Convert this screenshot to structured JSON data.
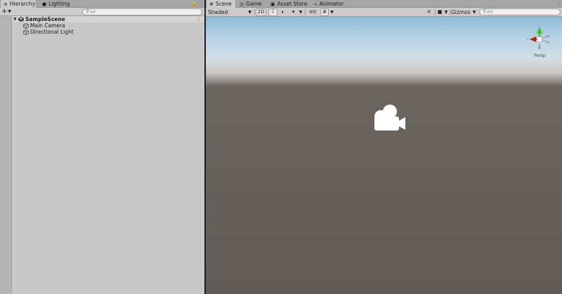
{
  "hierarchy": {
    "tabs": [
      {
        "label": "Hierarchy",
        "icon": "list-icon"
      },
      {
        "label": "Lighting",
        "icon": "lightbulb-icon"
      }
    ],
    "search_placeholder": "All",
    "add_label": "+",
    "scene": {
      "name": "SampleScene"
    },
    "items": [
      {
        "label": "Main Camera",
        "icon": "cube-icon"
      },
      {
        "label": "Directional Light",
        "icon": "cube-icon"
      }
    ]
  },
  "scene_view": {
    "tabs": [
      {
        "label": "Scene",
        "icon": "grid-icon"
      },
      {
        "label": "Game",
        "icon": "gamepad-icon"
      },
      {
        "label": "Asset Store",
        "icon": "shopping-bag-icon"
      },
      {
        "label": "Animator",
        "icon": "animator-icon"
      }
    ],
    "toolbar": {
      "shading_mode": "Shaded",
      "mode_2d": "2D",
      "hidden_count": "0",
      "gizmos_label": "Gizmos",
      "search_placeholder": "All"
    },
    "orientation_label": "Persp"
  },
  "colors": {
    "sky_top": "#8fb9d8",
    "ground": "#625c58",
    "panel_bg": "#c8c8c8",
    "gizmo_green": "#3fbf2a",
    "gizmo_red": "#b3261e"
  }
}
